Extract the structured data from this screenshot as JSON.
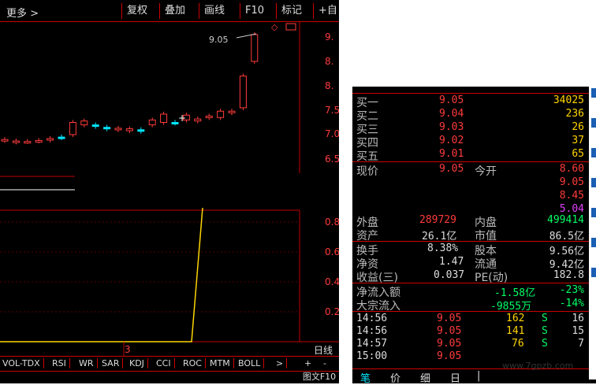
{
  "toolbar": {
    "more_label": "更多 >",
    "buttons": [
      "复权",
      "叠加",
      "画线",
      "F10",
      "标记",
      "+自"
    ]
  },
  "price_chart": {
    "y_ticks": [
      "9.",
      "8.",
      "8.",
      "7.50",
      "7.00",
      "6.50"
    ],
    "high_marker": "9.05",
    "candles_open_close": [
      [
        6.88,
        6.9
      ],
      [
        6.85,
        6.87
      ],
      [
        6.86,
        6.86
      ],
      [
        6.87,
        6.88
      ],
      [
        6.89,
        6.92
      ],
      [
        6.95,
        6.94
      ],
      [
        7.0,
        7.25
      ],
      [
        7.2,
        7.28
      ],
      [
        7.2,
        7.17
      ],
      [
        7.15,
        7.12
      ],
      [
        7.1,
        7.13
      ],
      [
        7.08,
        7.12
      ],
      [
        7.1,
        7.07
      ],
      [
        7.2,
        7.3
      ],
      [
        7.25,
        7.42
      ],
      [
        7.25,
        7.24
      ],
      [
        7.3,
        7.4
      ],
      [
        7.28,
        7.32
      ],
      [
        7.35,
        7.38
      ],
      [
        7.35,
        7.48
      ],
      [
        7.45,
        7.48
      ],
      [
        7.55,
        8.2
      ],
      [
        8.5,
        9.05
      ]
    ]
  },
  "volume_chart": {
    "y_ticks": [
      "0.80",
      "0.60",
      "0.40",
      "0.20"
    ],
    "cursor_label": "3"
  },
  "period_label": "日线",
  "indicators": [
    "VOL-TDX",
    "RSI",
    "WR",
    "SAR",
    "KDJ",
    "CCI",
    "ROC",
    "MTM",
    "BOLL",
    ">"
  ],
  "bottom_buttons": {
    "plus": "+",
    "minus": "-",
    "f10_text": "图文F10"
  },
  "quote": {
    "bids": [
      {
        "label": "买一",
        "price": "9.05",
        "vol": "34025"
      },
      {
        "label": "买二",
        "price": "9.04",
        "vol": "236"
      },
      {
        "label": "买三",
        "price": "9.03",
        "vol": "26"
      },
      {
        "label": "买四",
        "price": "9.02",
        "vol": "37"
      },
      {
        "label": "买五",
        "price": "9.01",
        "vol": "65"
      }
    ],
    "current_label": "现价",
    "current_price": "9.05",
    "open_label": "今开",
    "open_value": "8.60",
    "high_value": "9.05",
    "low_value": "8.45",
    "small_value": "5.04",
    "outer_label": "外盘",
    "outer_value": "289729",
    "inner_label": "内盘",
    "inner_value": "499414",
    "assets_label": "资产",
    "assets_value": "26.1亿",
    "mcap_label": "市值",
    "mcap_value": "86.5亿",
    "turnover_label": "换手",
    "turnover_value": "8.38%",
    "shares_label": "股本",
    "shares_value": "9.56亿",
    "netasset_label": "净资",
    "netasset_value": "1.47",
    "float_label": "流通",
    "float_value": "9.42亿",
    "eps_label": "收益(三)",
    "eps_value": "0.037",
    "pe_label": "PE(动)",
    "pe_value": "182.8",
    "netflow_label": "净流入额",
    "netflow_value": "-1.58亿",
    "netflow_pct": "-23%",
    "block_label": "大宗流入",
    "block_value": "-9855万",
    "block_pct": "-14%"
  },
  "ticks": [
    {
      "time": "14:56",
      "price": "9.05",
      "vol": "162",
      "side": "S",
      "n": "16"
    },
    {
      "time": "14:56",
      "price": "9.05",
      "vol": "141",
      "side": "S",
      "n": "15"
    },
    {
      "time": "14:57",
      "price": "9.05",
      "vol": "76",
      "side": "S",
      "n": "7"
    },
    {
      "time": "15:00",
      "price": "9.05",
      "vol": "",
      "side": "",
      "n": ""
    }
  ],
  "tabs": [
    "笔",
    "价",
    "细",
    "日",
    "|"
  ],
  "watermark": "www.7gpzb.com",
  "colors": {
    "up": "#ff3b3b",
    "down": "#00e5ff",
    "grid": "#c00000",
    "volume_line": "#ffd400",
    "sell": "#00ff66"
  }
}
